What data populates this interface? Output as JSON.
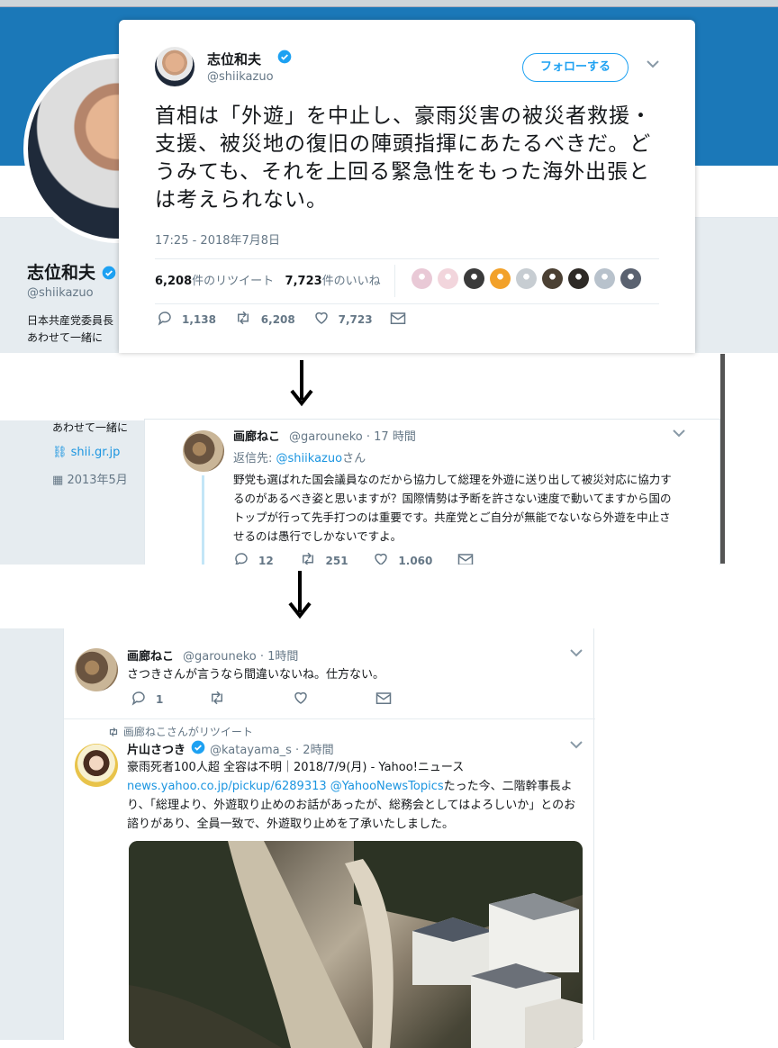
{
  "profile": {
    "name": "志位和夫",
    "handle": "@shiikazuo",
    "bio_line1": "日本共産党委員長",
    "bio_line2": "あわせて一緒に",
    "bio_line3": "あわせて一緒に",
    "link": "shii.gr.jp",
    "joined": "2013年5月"
  },
  "tweet_main": {
    "name": "志位和夫",
    "handle": "@shiikazuo",
    "follow_label": "フォローする",
    "text": "首相は「外遊」を中止し、豪雨災害の被災者救援・支援、被災地の復旧の陣頭指揮にあたるべきだ。どうみても、それを上回る緊急性をもった海外出張とは考えられない。",
    "timestamp": "17:25 - 2018年7月8日",
    "retweets_num": "6,208",
    "retweets_label": "件のリツイート",
    "likes_num": "7,723",
    "likes_label": "件のいいね",
    "reply_count": "1,138",
    "retweet_count": "6,208",
    "like_count": "7,723",
    "liker_colors": [
      "#e9c9d6",
      "#f2d5dc",
      "#3a3a3a",
      "#f2a12a",
      "#c7cdd2",
      "#4b4033",
      "#2e2a26",
      "#b8c2cc",
      "#5a6270"
    ]
  },
  "arrow1": "↓",
  "arrow2": "↓",
  "reply_tweet": {
    "name": "画廊ねこ",
    "handle": "@garouneko",
    "time": "· 17 時間",
    "reply_prefix": "返信先:",
    "reply_to": "@shiikazuo",
    "reply_suffix": "さん",
    "text": "野党も選ばれた国会議員なのだから協力して総理を外遊に送り出して被災対応に協力するのがあるべき姿と思いますが？国際情勢は予断を許さない速度で動いてますから国のトップが行って先手打つのは重要です。共産党とご自分が無能でないなら外遊を中止させるのは愚行でしかないですよ。",
    "reply_count": "12",
    "retweet_count": "251",
    "like_count": "1,060"
  },
  "tweet_a": {
    "name": "画廊ねこ",
    "handle": "@garouneko",
    "time": "· 1時間",
    "text": "さつきさんが言うなら間違いないね。仕方ない。",
    "reply_count": "1"
  },
  "tweet_b": {
    "retweeted_by": "画廊ねこさんがリツイート",
    "name": "片山さつき",
    "handle": "@katayama_s",
    "time": "· 2時間",
    "line1": "豪雨死者100人超 全容は不明｜2018/7/9(月) - Yahoo!ニュース",
    "link": "news.yahoo.co.jp/pickup/6289313",
    "mention": "@YahooNewsTopics",
    "text_rest": "たった今、二階幹事長より、「総理より、外遊取り止めのお話があったが、総務会としてはよろしいか」とのお諮りがあり、全員一致で、外遊取り止めを了承いたしました。"
  },
  "colors": {
    "accent": "#1da1f2",
    "link": "#1b95e0",
    "banner": "#1b78b8",
    "bg": "#e6ecf0"
  }
}
